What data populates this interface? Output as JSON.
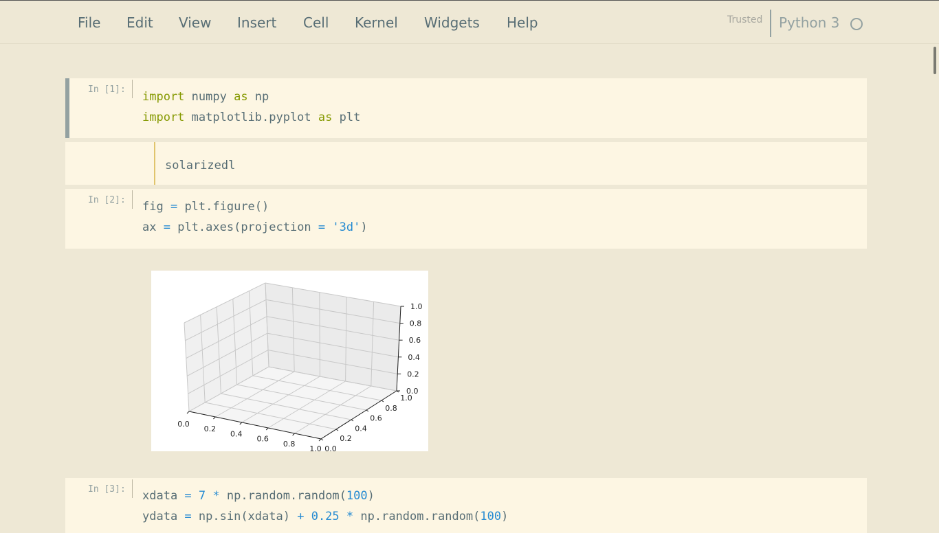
{
  "menubar": {
    "items": [
      "File",
      "Edit",
      "View",
      "Insert",
      "Cell",
      "Kernel",
      "Widgets",
      "Help"
    ],
    "trusted": "Trusted",
    "kernel_name": "Python 3"
  },
  "cells": {
    "c1": {
      "prompt": "In [1]:",
      "lines": [
        [
          [
            "kw",
            "import"
          ],
          [
            "t",
            " numpy "
          ],
          [
            "kw",
            "as"
          ],
          [
            "t",
            " np"
          ]
        ],
        [
          [
            "kw",
            "import"
          ],
          [
            "t",
            " matplotlib.pyplot "
          ],
          [
            "kw",
            "as"
          ],
          [
            "t",
            " plt"
          ]
        ]
      ]
    },
    "md": {
      "text": "solarizedl"
    },
    "c2": {
      "prompt": "In [2]:",
      "lines": [
        [
          [
            "t",
            "fig "
          ],
          [
            "op",
            "="
          ],
          [
            "t",
            " plt.figure()"
          ]
        ],
        [
          [
            "t",
            "ax "
          ],
          [
            "op",
            "="
          ],
          [
            "t",
            " plt.axes(projection "
          ],
          [
            "op",
            "="
          ],
          [
            "t",
            " "
          ],
          [
            "str",
            "'3d'"
          ],
          [
            "t",
            ")"
          ]
        ]
      ]
    },
    "c3": {
      "prompt": "In [3]:",
      "lines": [
        [
          [
            "t",
            "xdata "
          ],
          [
            "op",
            "="
          ],
          [
            "t",
            " "
          ],
          [
            "num",
            "7"
          ],
          [
            "t",
            " "
          ],
          [
            "op",
            "*"
          ],
          [
            "t",
            " np.random.random("
          ],
          [
            "num",
            "100"
          ],
          [
            "t",
            ")"
          ]
        ],
        [
          [
            "t",
            "ydata "
          ],
          [
            "op",
            "="
          ],
          [
            "t",
            " np.sin(xdata) "
          ],
          [
            "op",
            "+"
          ],
          [
            "t",
            " "
          ],
          [
            "num",
            "0.25"
          ],
          [
            "t",
            " "
          ],
          [
            "op",
            "*"
          ],
          [
            "t",
            " np.random.random("
          ],
          [
            "num",
            "100"
          ],
          [
            "t",
            ")"
          ]
        ]
      ]
    }
  },
  "chart_data": {
    "type": "3d-axes",
    "x_ticks": [
      "0.0",
      "0.2",
      "0.4",
      "0.6",
      "0.8",
      "1.0"
    ],
    "y_ticks": [
      "0.0",
      "0.2",
      "0.4",
      "0.6",
      "0.8",
      "1.0"
    ],
    "z_ticks": [
      "0.0",
      "0.2",
      "0.4",
      "0.6",
      "0.8",
      "1.0"
    ],
    "xlim": [
      0,
      1
    ],
    "ylim": [
      0,
      1
    ],
    "zlim": [
      0,
      1
    ],
    "grid": true
  },
  "colors": {
    "background": "#eee8d5",
    "cell": "#fdf6e3",
    "keyword": "#859900",
    "operator": "#268bd2"
  }
}
